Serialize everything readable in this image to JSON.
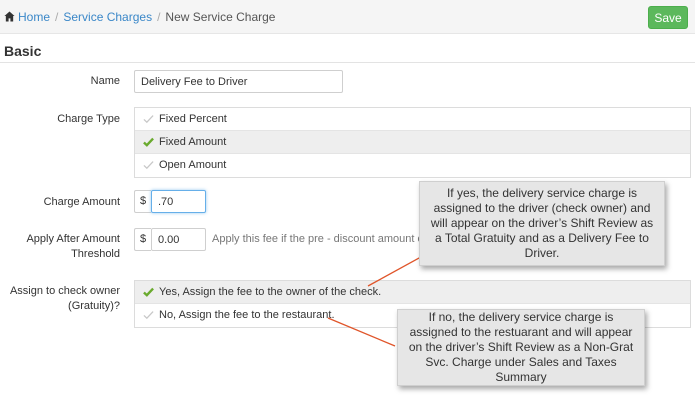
{
  "breadcrumb": {
    "home": "Home",
    "service_charges": "Service Charges",
    "current": "New Service Charge",
    "separator": "/"
  },
  "toolbar": {
    "save_label": "Save"
  },
  "section": {
    "title": "Basic"
  },
  "form": {
    "name": {
      "label": "Name",
      "value": "Delivery Fee to Driver"
    },
    "charge_type": {
      "label": "Charge Type",
      "options": [
        "Fixed Percent",
        "Fixed Amount",
        "Open Amount"
      ],
      "selected": "Fixed Amount"
    },
    "charge_amount": {
      "label": "Charge Amount",
      "prefix": "$",
      "value": ".70"
    },
    "apply_after": {
      "label_line1": "Apply After Amount",
      "label_line2": "Threshold",
      "prefix": "$",
      "value": "0.00",
      "hint": "Apply this fee if the pre - discount amount of the"
    },
    "assign_owner": {
      "label_line1": "Assign to check owner",
      "label_line2": "(Gratuity)?",
      "options": [
        "Yes, Assign the fee to the owner of the check.",
        "No, Assign the fee to the restaurant."
      ],
      "selected": "Yes, Assign the fee to the owner of the check."
    }
  },
  "callouts": {
    "yes": "If yes, the delivery service charge is assigned to the driver (check owner) and will appear on the driver’s Shift Review as a Total Gratuity and as a Delivery Fee to Driver.",
    "no": "If no, the delivery service charge is assigned to the restuarant and will appear on the driver’s Shift Review as a Non-Grat Svc. Charge under Sales and Taxes Summary"
  },
  "colors": {
    "link": "#3a87c8",
    "save_button": "#5cb85c",
    "check_selected": "#6aaa2e",
    "check_unselected": "#c8c8c8",
    "leader_line": "#e0552a"
  }
}
